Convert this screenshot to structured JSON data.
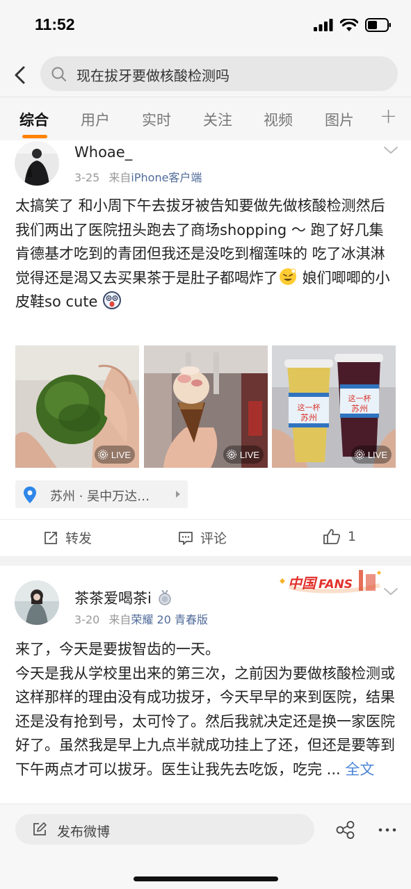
{
  "status": {
    "time": "11:52"
  },
  "search": {
    "query": "现在拔牙要做核酸检测吗"
  },
  "tabs": [
    {
      "label": "综合"
    },
    {
      "label": "用户"
    },
    {
      "label": "实时"
    },
    {
      "label": "关注"
    },
    {
      "label": "视频"
    },
    {
      "label": "图片"
    }
  ],
  "tab_more": "+",
  "post1": {
    "username": "Whoae_",
    "date": "3-25",
    "from_prefix": "来自",
    "source": "iPhone客户端",
    "text_1": "太搞笑了 和小周下午去拔牙被告知要做先做核酸检测然后我们两出了医院扭头跑去了商场shopping ～ 跑了好几集肯德基才吃到的青团但我还是没吃到榴莲味的 吃了冰淇淋觉得还是渴又去买果茶于是肚子都喝炸了",
    "text_2": " 娘们唧唧的小皮鞋so cute ",
    "photos": [
      {
        "badge": "LIVE",
        "subject": "qingtuan"
      },
      {
        "badge": "LIVE",
        "subject": "ice-cream"
      },
      {
        "badge": "LIVE",
        "subject": "fruit-tea"
      }
    ],
    "cup_text_1": "这一杯",
    "cup_text_2": "苏州",
    "location": "苏州 · 吴中万达…",
    "actions": {
      "repost": "转发",
      "comment": "评论",
      "like": "1"
    }
  },
  "post2": {
    "username": "茶茶爱喝茶i",
    "badge_text": "FANS",
    "badge_prefix": "中国",
    "date": "3-20",
    "from_prefix": "来自",
    "source": "荣耀 20 青春版",
    "text": "来了，今天是要拔智齿的一天。\n今天是我从学校里出来的第三次，之前因为要做核酸检测或这样那样的理由没有成功拔牙，今天早早的来到医院，结果还是没有抢到号，太可怜了。然后我就决定还是换一家医院好了。虽然我是早上九点半就成功挂上了还，但还是要等到下午两点才可以拔牙。医生让我先去吃饭，吃完 ...",
    "more_link": "全文"
  },
  "bottom": {
    "compose_label": "发布微博"
  },
  "colors": {
    "accent": "#ff8200",
    "link": "#506b9a",
    "more_link": "#4a84d6"
  }
}
